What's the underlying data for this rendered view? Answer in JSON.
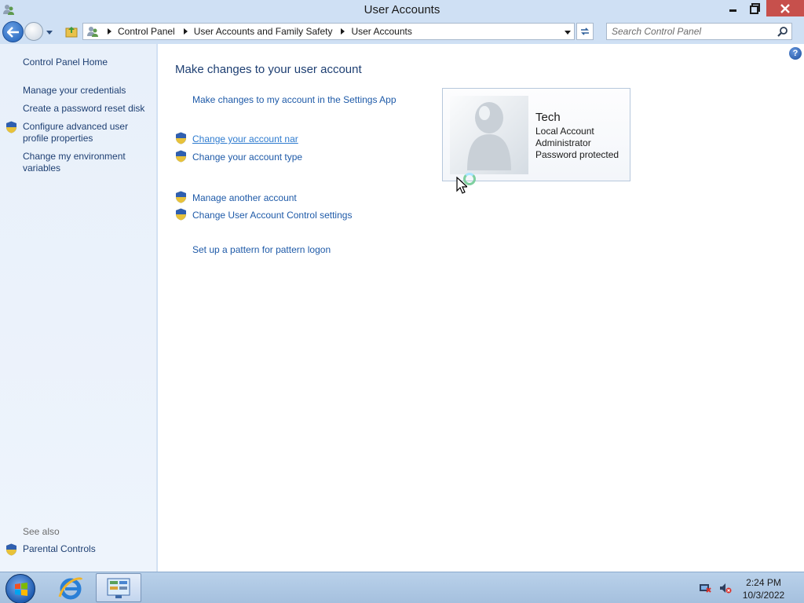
{
  "window": {
    "title": "User Accounts"
  },
  "address_bar": {
    "breadcrumbs": [
      "Control Panel",
      "User Accounts and Family Safety",
      "User Accounts"
    ]
  },
  "search": {
    "placeholder": "Search Control Panel"
  },
  "sidebar": {
    "home": "Control Panel Home",
    "links": [
      {
        "label": "Manage your credentials",
        "shield": false
      },
      {
        "label": "Create a password reset disk",
        "shield": false
      },
      {
        "label": "Configure advanced user profile properties",
        "shield": true
      },
      {
        "label": "Change my environment variables",
        "shield": false
      }
    ],
    "see_also_label": "See also",
    "see_also": [
      {
        "label": "Parental Controls",
        "shield": true
      }
    ]
  },
  "main": {
    "heading": "Make changes to your user account",
    "tasks": [
      {
        "label": "Make changes to my account in the Settings App",
        "shield": false
      },
      {
        "label": "Change your account nar",
        "shield": true,
        "hover": true
      },
      {
        "label": "Change your account type",
        "shield": true
      },
      {
        "label": "Manage another account",
        "shield": true
      },
      {
        "label": "Change User Account Control settings",
        "shield": true
      },
      {
        "label": "Set up a pattern for pattern logon",
        "shield": false
      }
    ]
  },
  "user": {
    "name": "Tech",
    "details": [
      "Local Account",
      "Administrator",
      "Password protected"
    ]
  },
  "taskbar": {
    "time": "2:24 PM",
    "date": "10/3/2022"
  },
  "colors": {
    "link": "#1e5aa8",
    "heading": "#1e3f72",
    "close_button": "#c7504c",
    "chrome": "#cfe0f4"
  }
}
